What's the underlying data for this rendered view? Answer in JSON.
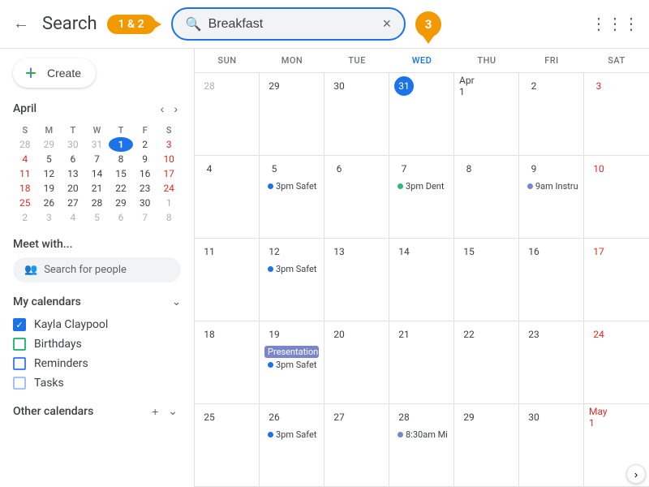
{
  "header": {
    "back_label": "←",
    "search_label": "Search",
    "badge1": "1 & 2",
    "search_value": "Breakfast",
    "clear_label": "×",
    "dropdown_label": "▾",
    "grid_label": "⋮⋮⋮"
  },
  "sidebar": {
    "create_label": "Create",
    "month_title": "April",
    "nav_prev": "‹",
    "nav_next": "›",
    "mini_cal": {
      "headers": [
        "S",
        "M",
        "T",
        "W",
        "T",
        "F",
        "S"
      ],
      "weeks": [
        [
          {
            "day": "28",
            "cls": "other-month"
          },
          {
            "day": "29",
            "cls": "other-month"
          },
          {
            "day": "30",
            "cls": "other-month"
          },
          {
            "day": "31",
            "cls": "other-month"
          },
          {
            "day": "1",
            "cls": "today"
          },
          {
            "day": "2",
            "cls": ""
          },
          {
            "day": "3",
            "cls": "sat"
          }
        ],
        [
          {
            "day": "4",
            "cls": "sun"
          },
          {
            "day": "5",
            "cls": ""
          },
          {
            "day": "6",
            "cls": ""
          },
          {
            "day": "7",
            "cls": ""
          },
          {
            "day": "8",
            "cls": ""
          },
          {
            "day": "9",
            "cls": ""
          },
          {
            "day": "10",
            "cls": "sat"
          }
        ],
        [
          {
            "day": "11",
            "cls": "sun"
          },
          {
            "day": "12",
            "cls": ""
          },
          {
            "day": "13",
            "cls": ""
          },
          {
            "day": "14",
            "cls": ""
          },
          {
            "day": "15",
            "cls": ""
          },
          {
            "day": "16",
            "cls": ""
          },
          {
            "day": "17",
            "cls": "sat"
          }
        ],
        [
          {
            "day": "18",
            "cls": "sun"
          },
          {
            "day": "19",
            "cls": ""
          },
          {
            "day": "20",
            "cls": ""
          },
          {
            "day": "21",
            "cls": ""
          },
          {
            "day": "22",
            "cls": ""
          },
          {
            "day": "23",
            "cls": ""
          },
          {
            "day": "24",
            "cls": "sat"
          }
        ],
        [
          {
            "day": "25",
            "cls": "sun"
          },
          {
            "day": "26",
            "cls": ""
          },
          {
            "day": "27",
            "cls": ""
          },
          {
            "day": "28",
            "cls": ""
          },
          {
            "day": "29",
            "cls": ""
          },
          {
            "day": "30",
            "cls": ""
          },
          {
            "day": "1",
            "cls": "sat other-month"
          }
        ],
        [
          {
            "day": "2",
            "cls": "sun other-month"
          },
          {
            "day": "3",
            "cls": "other-month"
          },
          {
            "day": "4",
            "cls": "other-month"
          },
          {
            "day": "5",
            "cls": "other-month"
          },
          {
            "day": "6",
            "cls": "other-month"
          },
          {
            "day": "7",
            "cls": "other-month"
          },
          {
            "day": "8",
            "cls": "sat other-month"
          }
        ]
      ]
    },
    "meet_with": "Meet with...",
    "people_search": "Search for people",
    "my_calendars_label": "My calendars",
    "calendars": [
      {
        "name": "Kayla Claypool",
        "type": "filled"
      },
      {
        "name": "Birthdays",
        "type": "green-outline"
      },
      {
        "name": "Reminders",
        "type": "blue-outline"
      },
      {
        "name": "Tasks",
        "type": "light-blue-outline"
      }
    ],
    "other_calendars_label": "Other calendars",
    "add_label": "+",
    "collapse_label": "⌄"
  },
  "calendar": {
    "days": [
      "SUN",
      "MON",
      "TUE",
      "WED",
      "THU",
      "FRI",
      "SAT"
    ],
    "today_col_index": 3,
    "rows": [
      {
        "cells": [
          {
            "day": "28",
            "cls": "other-month"
          },
          {
            "day": "29",
            "cls": ""
          },
          {
            "day": "30",
            "cls": ""
          },
          {
            "day": "31",
            "cls": "today",
            "events": []
          },
          {
            "day": "Apr 1",
            "cls": ""
          },
          {
            "day": "2",
            "cls": ""
          },
          {
            "day": "3",
            "cls": "red"
          }
        ]
      },
      {
        "cells": [
          {
            "day": "4",
            "cls": ""
          },
          {
            "day": "5",
            "cls": "",
            "events": [
              {
                "label": "3pm Safet",
                "color": "#1a73e8",
                "type": "dot"
              }
            ]
          },
          {
            "day": "6",
            "cls": ""
          },
          {
            "day": "7",
            "cls": "",
            "events": [
              {
                "label": "3pm Dent",
                "color": "#33b679",
                "type": "dot"
              }
            ]
          },
          {
            "day": "8",
            "cls": ""
          },
          {
            "day": "9",
            "cls": "",
            "events": [
              {
                "label": "9am Instru",
                "color": "#7986cb",
                "type": "dot"
              }
            ]
          },
          {
            "day": "10",
            "cls": "red"
          }
        ]
      },
      {
        "cells": [
          {
            "day": "11",
            "cls": ""
          },
          {
            "day": "12",
            "cls": "",
            "events": [
              {
                "label": "3pm Safet",
                "color": "#1a73e8",
                "type": "dot"
              }
            ]
          },
          {
            "day": "13",
            "cls": ""
          },
          {
            "day": "14",
            "cls": ""
          },
          {
            "day": "15",
            "cls": ""
          },
          {
            "day": "16",
            "cls": ""
          },
          {
            "day": "17",
            "cls": "red"
          }
        ]
      },
      {
        "cells": [
          {
            "day": "18",
            "cls": ""
          },
          {
            "day": "19",
            "cls": "",
            "events": [
              {
                "label": "Presentation",
                "color": "#7986cb",
                "type": "bg"
              },
              {
                "label": "3pm Safet",
                "color": "#1a73e8",
                "type": "dot"
              }
            ]
          },
          {
            "day": "20",
            "cls": ""
          },
          {
            "day": "21",
            "cls": ""
          },
          {
            "day": "22",
            "cls": ""
          },
          {
            "day": "23",
            "cls": ""
          },
          {
            "day": "24",
            "cls": "red"
          }
        ]
      },
      {
        "cells": [
          {
            "day": "25",
            "cls": ""
          },
          {
            "day": "26",
            "cls": "",
            "events": [
              {
                "label": "3pm Safet",
                "color": "#1a73e8",
                "type": "dot"
              }
            ]
          },
          {
            "day": "27",
            "cls": ""
          },
          {
            "day": "28",
            "cls": "",
            "events": [
              {
                "label": "8:30am Mi",
                "color": "#7986cb",
                "type": "dot"
              }
            ]
          },
          {
            "day": "29",
            "cls": ""
          },
          {
            "day": "30",
            "cls": ""
          },
          {
            "day": "May 1",
            "cls": "red other-month"
          }
        ]
      }
    ]
  },
  "badge3": "3"
}
